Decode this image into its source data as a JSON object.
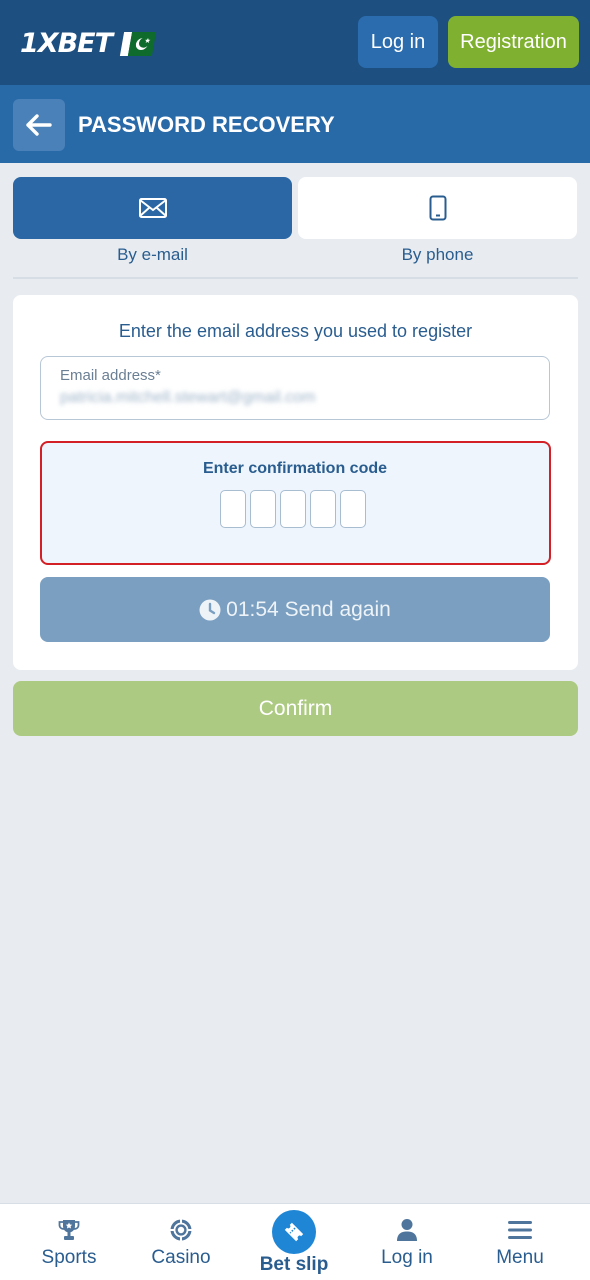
{
  "header": {
    "logo_text": "1XBET",
    "login_label": "Log in",
    "register_label": "Registration"
  },
  "titlebar": {
    "back_icon": "arrow-left-icon",
    "title": "PASSWORD RECOVERY"
  },
  "tabs": [
    {
      "label": "By e-mail",
      "icon": "envelope-icon",
      "active": true
    },
    {
      "label": "By phone",
      "icon": "phone-icon",
      "active": false
    }
  ],
  "form": {
    "instruction": "Enter the email address you used to register",
    "email_label": "Email address*",
    "email_value": "patricia.mitchell.stewart@gmail.com",
    "code_title": "Enter confirmation code",
    "code_cell_count": 5,
    "timer": "01:54",
    "send_again_label": "Send again",
    "confirm_label": "Confirm"
  },
  "bottom_nav": [
    {
      "label": "Sports",
      "icon": "trophy-icon"
    },
    {
      "label": "Casino",
      "icon": "casino-chip-icon"
    },
    {
      "label": "Bet slip",
      "icon": "ticket-icon"
    },
    {
      "label": "Log in",
      "icon": "user-icon"
    },
    {
      "label": "Menu",
      "icon": "hamburger-icon"
    }
  ],
  "colors": {
    "header_bg": "#1d4f80",
    "titlebar_bg": "#2869a8",
    "accent_green": "#7fb030",
    "highlight_red": "#d31f26"
  }
}
